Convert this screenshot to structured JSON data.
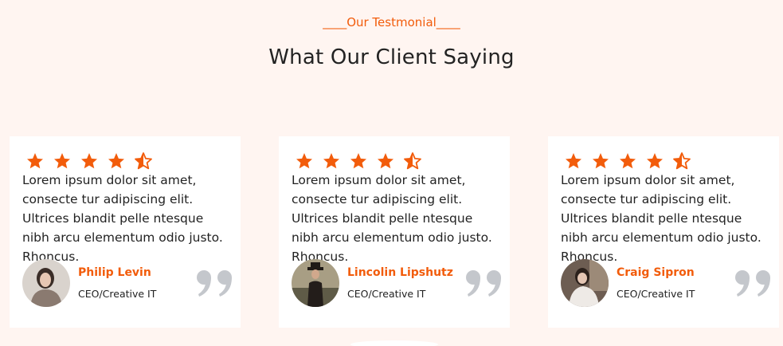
{
  "section": {
    "eyebrow": "____Our Testmonial____",
    "heading": "What Our Client Saying"
  },
  "colors": {
    "accent": "#f25c0b",
    "background": "#fff5f1",
    "card": "#ffffff",
    "quote_icon": "#c4c7cc"
  },
  "testimonials": [
    {
      "rating": 4.5,
      "text": "Lorem ipsum dolor sit amet, consecte tur adipiscing elit. Ultrices blandit pelle ntesque nibh arcu elementum odio justo. Rhoncus.",
      "name": "Philip Levin",
      "role": "CEO/Creative IT"
    },
    {
      "rating": 4.5,
      "text": "Lorem ipsum dolor sit amet, consecte tur adipiscing elit. Ultrices blandit pelle ntesque nibh arcu elementum odio justo. Rhoncus.",
      "name": "Lincolin Lipshutz",
      "role": "CEO/Creative IT"
    },
    {
      "rating": 4.5,
      "text": "Lorem ipsum dolor sit amet, consecte tur adipiscing elit. Ultrices blandit pelle ntesque nibh arcu elementum odio justo. Rhoncus.",
      "name": "Craig Sipron",
      "role": "CEO/Creative IT"
    }
  ]
}
